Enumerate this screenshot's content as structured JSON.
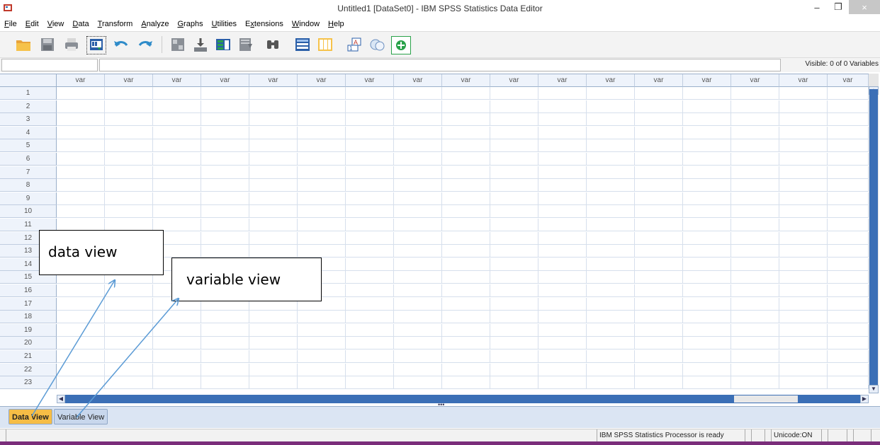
{
  "window": {
    "title": "Untitled1 [DataSet0] - IBM SPSS Statistics Data Editor",
    "app_icon": "spss-app-icon",
    "controls": [
      "–",
      "❐",
      "×"
    ]
  },
  "menu": {
    "items": [
      {
        "pre": "",
        "u": "F",
        "post": "ile"
      },
      {
        "pre": "",
        "u": "E",
        "post": "dit"
      },
      {
        "pre": "",
        "u": "V",
        "post": "iew"
      },
      {
        "pre": "",
        "u": "D",
        "post": "ata"
      },
      {
        "pre": "",
        "u": "T",
        "post": "ransform"
      },
      {
        "pre": "",
        "u": "A",
        "post": "nalyze"
      },
      {
        "pre": "",
        "u": "G",
        "post": "raphs"
      },
      {
        "pre": "",
        "u": "U",
        "post": "tilities"
      },
      {
        "pre": "E",
        "u": "x",
        "post": "tensions"
      },
      {
        "pre": "",
        "u": "W",
        "post": "indow"
      },
      {
        "pre": "",
        "u": "H",
        "post": "elp"
      }
    ]
  },
  "toolbar": {
    "icons": [
      "open-icon",
      "save-icon",
      "print-icon",
      "recall-dialog-icon",
      "undo-icon",
      "redo-icon",
      "goto-case-icon",
      "goto-variable-icon",
      "variables-icon",
      "run-descriptives-icon",
      "find-icon",
      "insert-cases-icon",
      "insert-variable-icon",
      "split-file-icon",
      "value-labels-icon",
      "use-sets-icon"
    ]
  },
  "cellbar": {
    "cell_ref": "",
    "cell_value": "",
    "visible_info": "Visible: 0 of 0 Variables"
  },
  "grid": {
    "column_header": "var",
    "column_count": 17,
    "rows": [
      "1",
      "2",
      "3",
      "4",
      "5",
      "6",
      "7",
      "8",
      "9",
      "10",
      "11",
      "12",
      "13",
      "14",
      "15",
      "16",
      "17",
      "18",
      "19",
      "20",
      "21",
      "22",
      "23"
    ]
  },
  "tabs": {
    "data_view": "Data View",
    "variable_view": "Variable View"
  },
  "status": {
    "processor": "IBM SPSS Statistics Processor is ready",
    "unicode": "Unicode:ON"
  },
  "annotations": {
    "data_view": "data view",
    "variable_view": "variable view",
    "arrow_color": "#5b9bd5"
  }
}
